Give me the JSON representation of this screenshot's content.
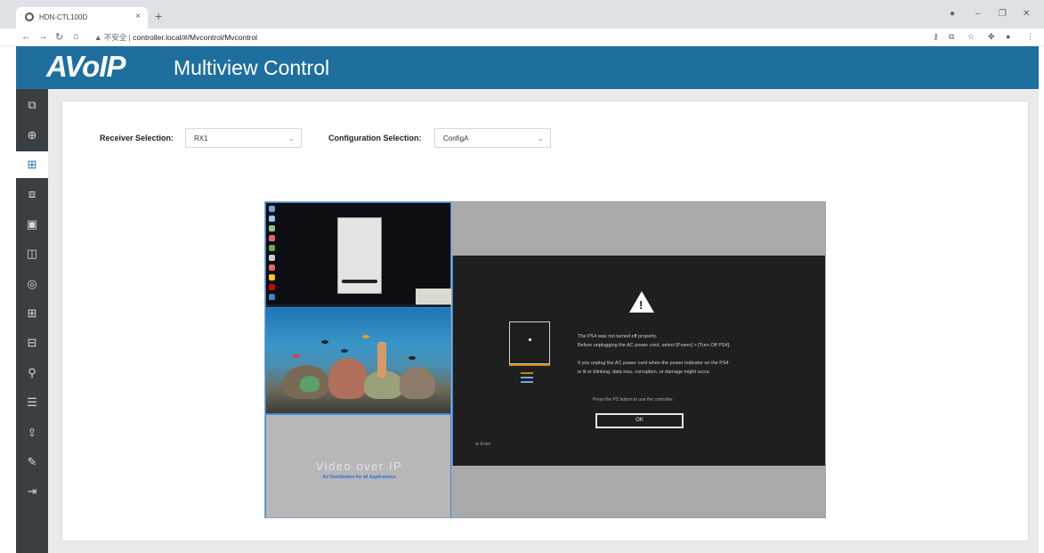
{
  "browser": {
    "tab_title": "HDN-CTL100D",
    "tab_close": "×",
    "new_tab": "+",
    "url_security": "▲ 不安全 |",
    "url": "controller.local/#/Mvcontrol/Mvcontrol",
    "window_controls": [
      "–",
      "❐",
      "✕"
    ]
  },
  "app": {
    "logo": "AVoIP",
    "title": "Multiview Control"
  },
  "sidebar": {
    "items": [
      {
        "icon": "preview-icon",
        "glyph": "⧉"
      },
      {
        "icon": "add-circle-icon",
        "glyph": "⊕"
      },
      {
        "icon": "multiview-icon",
        "glyph": "⊞",
        "active": true
      },
      {
        "icon": "layers-icon",
        "glyph": "⧈"
      },
      {
        "icon": "media-icon",
        "glyph": "▣"
      },
      {
        "icon": "display-icon",
        "glyph": "◫"
      },
      {
        "icon": "signal-icon",
        "glyph": "◎"
      },
      {
        "icon": "grid-icon",
        "glyph": "⊞"
      },
      {
        "icon": "videowall-icon",
        "glyph": "⊟"
      },
      {
        "icon": "user-icon",
        "glyph": "⚲"
      },
      {
        "icon": "settings-icon",
        "glyph": "☰"
      },
      {
        "icon": "upload-icon",
        "glyph": "⇪"
      },
      {
        "icon": "tools-icon",
        "glyph": "✎"
      },
      {
        "icon": "logout-icon",
        "glyph": "⇥"
      }
    ]
  },
  "selection": {
    "receiver_label": "Receiver Selection:",
    "receiver_value": "RX1",
    "config_label": "Configuration Selection:",
    "config_value": "ConfigA"
  },
  "preview": {
    "vop_title": "Video over IP",
    "vop_subtitle": "AV Distribution for all Applications",
    "ps_message_1": "The PS4 was not turned off properly.",
    "ps_message_2": "Before unplugging the AC power cord, select [Power] > [Turn Off PS4].",
    "ps_message_3": "If you unplug the AC power cord when the power indicator on the PS4",
    "ps_message_4": "is lit or blinking, data loss, corruption, or damage might occur.",
    "ps_hint": "Press the PS button to use the controller.",
    "ok_label": "OK",
    "enter_label": "⊗ Enter"
  }
}
